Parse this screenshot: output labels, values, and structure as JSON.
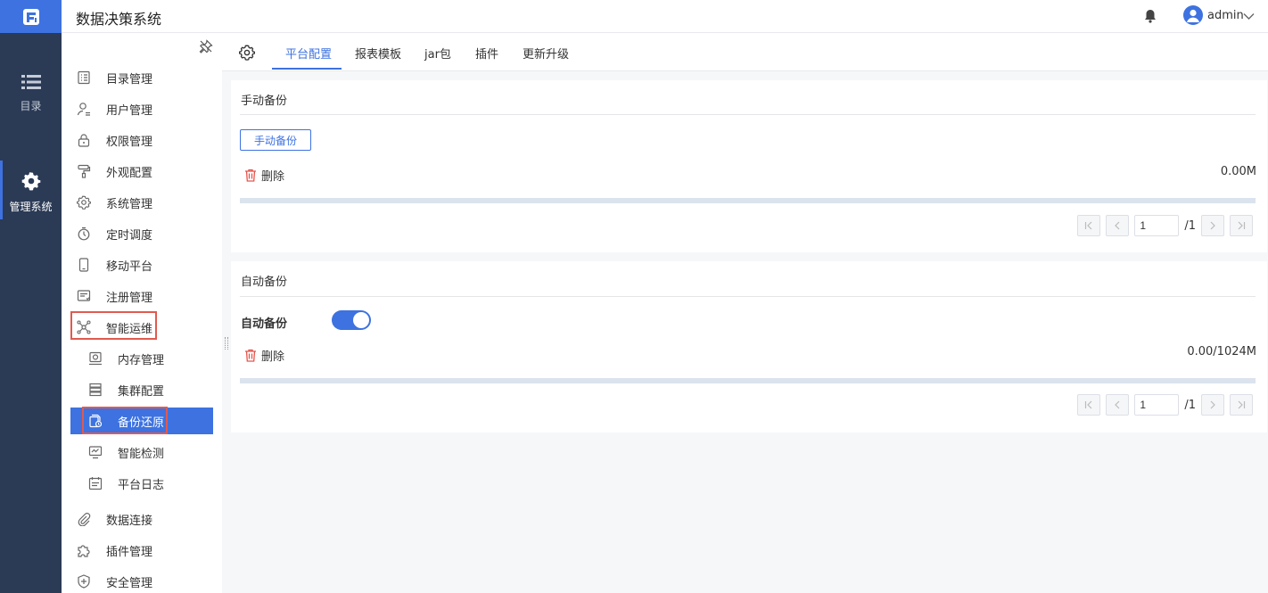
{
  "app": {
    "title": "数据决策系统"
  },
  "header": {
    "user": "admin"
  },
  "rail": {
    "items": [
      {
        "label": "目录",
        "icon": "list-icon"
      },
      {
        "label": "管理系统",
        "icon": "gear-icon"
      }
    ]
  },
  "sidebar": {
    "items": [
      {
        "label": "目录管理"
      },
      {
        "label": "用户管理"
      },
      {
        "label": "权限管理"
      },
      {
        "label": "外观配置"
      },
      {
        "label": "系统管理"
      },
      {
        "label": "定时调度"
      },
      {
        "label": "移动平台"
      },
      {
        "label": "注册管理"
      },
      {
        "label": "智能运维"
      },
      {
        "label": "内存管理"
      },
      {
        "label": "集群配置"
      },
      {
        "label": "备份还原"
      },
      {
        "label": "智能检测"
      },
      {
        "label": "平台日志"
      },
      {
        "label": "数据连接"
      },
      {
        "label": "插件管理"
      },
      {
        "label": "安全管理"
      }
    ]
  },
  "tabs": [
    {
      "label": "平台配置"
    },
    {
      "label": "报表模板"
    },
    {
      "label": "jar包"
    },
    {
      "label": "插件"
    },
    {
      "label": "更新升级"
    }
  ],
  "manual": {
    "title": "手动备份",
    "button": "手动备份",
    "delete": "删除",
    "size": "0.00M",
    "page": "1",
    "total": "/1"
  },
  "auto": {
    "title": "自动备份",
    "toggle_label": "自动备份",
    "toggle_on": true,
    "delete": "删除",
    "size": "0.00/1024M",
    "page": "1",
    "total": "/1"
  },
  "colors": {
    "accent": "#3d72e0",
    "rail": "#2b3a55",
    "highlight": "#e05a4f",
    "danger": "#e5544b"
  }
}
